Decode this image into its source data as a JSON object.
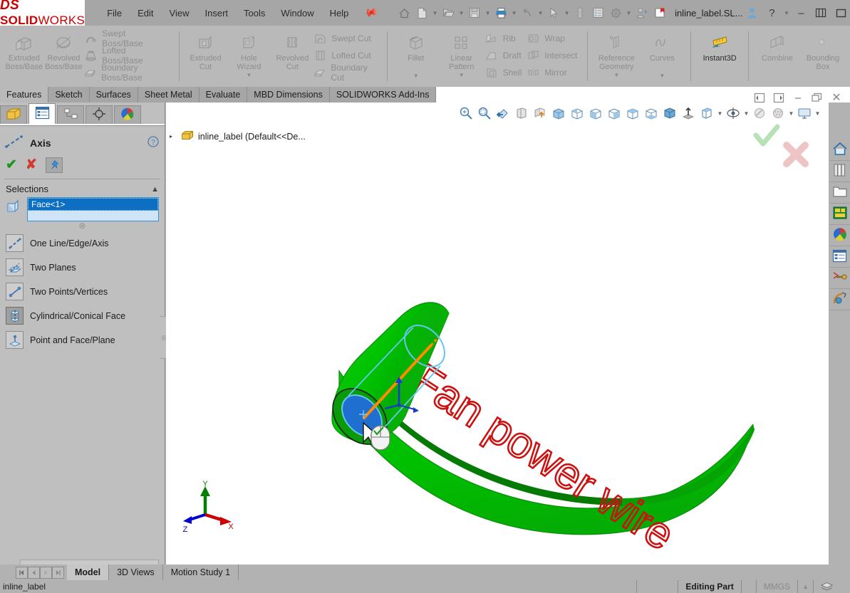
{
  "app": {
    "brand_ds": "DS",
    "brand_solid": "SOLID",
    "brand_works": "WORKS",
    "document_title": "inline_label.SL...",
    "accent_red": "#cc0000",
    "accent_blue": "#2a78c4",
    "model_green": "#00c000",
    "label_red": "#cc1111"
  },
  "menubar": {
    "items": [
      {
        "label": "File"
      },
      {
        "label": "Edit"
      },
      {
        "label": "View"
      },
      {
        "label": "Insert"
      },
      {
        "label": "Tools"
      },
      {
        "label": "Window"
      },
      {
        "label": "Help"
      }
    ],
    "pin_icon": "pushpin-icon"
  },
  "quick_access": {
    "buttons": [
      {
        "name": "home-icon"
      },
      {
        "name": "new-document-icon"
      },
      {
        "name": "open-folder-icon"
      },
      {
        "name": "save-icon"
      },
      {
        "name": "print-icon"
      },
      {
        "name": "undo-icon"
      },
      {
        "name": "select-arrow-icon"
      },
      {
        "name": "rebuild-icon"
      },
      {
        "name": "options-list-icon"
      },
      {
        "name": "gear-icon"
      },
      {
        "name": "user-login-icon"
      },
      {
        "name": "flag-icon"
      }
    ],
    "right_icons": [
      {
        "name": "user-account-icon"
      },
      {
        "name": "help-question-icon"
      }
    ]
  },
  "window_controls": {
    "minimize": "–",
    "restore": "❐",
    "close": "✕"
  },
  "ribbon": {
    "groups": [
      {
        "name": "boss-base-group",
        "big": [
          {
            "label_line1": "Extruded",
            "label_line2": "Boss/Base",
            "icon": "extruded-boss-icon",
            "enabled": false
          },
          {
            "label_line1": "Revolved",
            "label_line2": "Boss/Base",
            "icon": "revolved-boss-icon",
            "enabled": false
          }
        ],
        "list": [
          {
            "label": "Swept Boss/Base",
            "icon": "swept-boss-icon"
          },
          {
            "label": "Lofted Boss/Base",
            "icon": "lofted-boss-icon"
          },
          {
            "label": "Boundary Boss/Base",
            "icon": "boundary-boss-icon"
          }
        ]
      },
      {
        "name": "cut-group",
        "big": [
          {
            "label_line1": "Extruded",
            "label_line2": "Cut",
            "icon": "extruded-cut-icon",
            "enabled": false
          },
          {
            "label_line1": "Hole",
            "label_line2": "Wizard",
            "icon": "hole-wizard-icon",
            "enabled": false,
            "has_dropdown": true
          },
          {
            "label_line1": "Revolved",
            "label_line2": "Cut",
            "icon": "revolved-cut-icon",
            "enabled": false
          }
        ],
        "list": [
          {
            "label": "Swept Cut",
            "icon": "swept-cut-icon"
          },
          {
            "label": "Lofted Cut",
            "icon": "lofted-cut-icon"
          },
          {
            "label": "Boundary Cut",
            "icon": "boundary-cut-icon"
          }
        ]
      },
      {
        "name": "feature-group",
        "big": [
          {
            "label_line1": "Fillet",
            "label_line2": "",
            "icon": "fillet-icon",
            "enabled": false,
            "has_dropdown": true
          },
          {
            "label_line1": "Linear",
            "label_line2": "Pattern",
            "icon": "linear-pattern-icon",
            "enabled": false,
            "has_dropdown": true
          }
        ],
        "list": [
          {
            "label": "Rib",
            "icon": "rib-icon"
          },
          {
            "label": "Draft",
            "icon": "draft-icon"
          },
          {
            "label": "Shell",
            "icon": "shell-icon"
          }
        ],
        "list2": [
          {
            "label": "Wrap",
            "icon": "wrap-icon"
          },
          {
            "label": "Intersect",
            "icon": "intersect-icon"
          },
          {
            "label": "Mirror",
            "icon": "mirror-icon"
          }
        ]
      },
      {
        "name": "reference-group",
        "big": [
          {
            "label_line1": "Reference",
            "label_line2": "Geometry",
            "icon": "reference-geometry-icon",
            "enabled": false,
            "has_dropdown": true
          },
          {
            "label_line1": "Curves",
            "label_line2": "",
            "icon": "curves-icon",
            "enabled": false,
            "has_dropdown": true
          }
        ]
      },
      {
        "name": "instant3d-group",
        "big": [
          {
            "label_line1": "Instant3D",
            "label_line2": "",
            "icon": "instant3d-icon",
            "enabled": true
          }
        ]
      },
      {
        "name": "combine-group",
        "big": [
          {
            "label_line1": "Combine",
            "label_line2": "",
            "icon": "combine-icon",
            "enabled": false
          },
          {
            "label_line1": "Bounding",
            "label_line2": "Box",
            "icon": "bounding-box-icon",
            "enabled": false
          }
        ]
      }
    ]
  },
  "command_tabs": {
    "items": [
      {
        "label": "Features",
        "active": true
      },
      {
        "label": "Sketch",
        "active": false
      },
      {
        "label": "Surfaces",
        "active": false
      },
      {
        "label": "Sheet Metal",
        "active": false
      },
      {
        "label": "Evaluate",
        "active": false
      },
      {
        "label": "MBD Dimensions",
        "active": false
      },
      {
        "label": "SOLIDWORKS Add-Ins",
        "active": false
      }
    ]
  },
  "property_manager": {
    "tabs": [
      {
        "name": "feature-tree-tab",
        "icon": "feature-tree-icon",
        "active": false
      },
      {
        "name": "property-manager-tab",
        "icon": "property-manager-icon",
        "active": true
      },
      {
        "name": "configuration-manager-tab",
        "icon": "configuration-icon",
        "active": false
      },
      {
        "name": "dimxpert-manager-tab",
        "icon": "dimxpert-icon",
        "active": false
      },
      {
        "name": "display-manager-tab",
        "icon": "appearance-sphere-icon",
        "active": false
      }
    ],
    "title": "Axis",
    "title_icon": "axis-icon",
    "help_icon": "help-circle-icon",
    "actions": {
      "ok": "✔",
      "cancel": "✘",
      "pin": "pushpin-icon"
    },
    "sections": [
      {
        "name": "selections-section",
        "header": "Selections",
        "collapse_icon": "chevron-up-icon",
        "selection_box_icon": "face-selection-icon",
        "selected_items": [
          "Face<1>"
        ],
        "options": [
          {
            "label": "One Line/Edge/Axis",
            "icon": "line-edge-axis-icon",
            "selected": false
          },
          {
            "label": "Two Planes",
            "icon": "two-planes-icon",
            "selected": false
          },
          {
            "label": "Two Points/Vertices",
            "icon": "two-points-icon",
            "selected": false
          },
          {
            "label": "Cylindrical/Conical Face",
            "icon": "cylindrical-face-icon",
            "selected": true
          },
          {
            "label": "Point and Face/Plane",
            "icon": "point-and-face-icon",
            "selected": false
          }
        ]
      }
    ]
  },
  "graphics": {
    "view_toolbar": [
      {
        "name": "zoom-to-fit-icon"
      },
      {
        "name": "zoom-to-area-icon"
      },
      {
        "name": "previous-view-icon"
      },
      {
        "name": "section-view-icon"
      },
      {
        "name": "view-orientation-icon"
      },
      {
        "name": "front-view-icon"
      },
      {
        "name": "back-view-icon"
      },
      {
        "name": "left-view-icon"
      },
      {
        "name": "right-view-icon"
      },
      {
        "name": "top-view-icon"
      },
      {
        "name": "bottom-view-icon"
      },
      {
        "name": "isometric-view-icon"
      },
      {
        "name": "normal-to-icon"
      },
      {
        "name": "display-style-icon",
        "has_dropdown": true
      },
      {
        "name": "hide-show-items-icon",
        "has_dropdown": true
      },
      {
        "name": "edit-appearance-icon"
      },
      {
        "name": "apply-scene-icon",
        "has_dropdown": true
      },
      {
        "name": "view-settings-icon",
        "has_dropdown": true
      }
    ],
    "window_buttons": [
      {
        "name": "restore-down-left-icon",
        "glyph": "◀"
      },
      {
        "name": "restore-down-right-icon",
        "glyph": "▶"
      },
      {
        "name": "minimize-doc-icon",
        "glyph": "–"
      },
      {
        "name": "restore-doc-icon",
        "glyph": "❐"
      },
      {
        "name": "close-doc-icon",
        "glyph": "✕"
      }
    ],
    "tree": {
      "expand_arrow": "▸",
      "part_icon": "part-icon",
      "label": "inline_label  (Default<<De..."
    },
    "confirmation_corner": {
      "ok_icon": "checkmark-icon",
      "cancel_icon": "cross-icon"
    },
    "triad": {
      "x_label": "X",
      "y_label": "Y",
      "z_label": "Z",
      "x_color": "#cc0000",
      "y_color": "#008000",
      "z_color": "#0000cc"
    },
    "model": {
      "label_text": "Fan power wire",
      "body_color": "#00c000",
      "selected_face_color": "#1f6fd0",
      "axis_preview_color": "#ff8c00",
      "highlight_color": "#66c6f0",
      "cursor": "select-face-cursor"
    }
  },
  "task_pane": {
    "buttons": [
      {
        "name": "solidworks-resources-icon"
      },
      {
        "name": "design-library-icon"
      },
      {
        "name": "file-explorer-icon"
      },
      {
        "name": "view-palette-icon"
      },
      {
        "name": "appearances-scenes-icon"
      },
      {
        "name": "custom-properties-icon"
      },
      {
        "name": "solidworks-forum-icon"
      },
      {
        "name": "mbd-icon"
      }
    ]
  },
  "bottom_tabs": {
    "nav": [
      {
        "name": "first-tab-button",
        "glyph": "⏮"
      },
      {
        "name": "prev-tab-button",
        "glyph": "◀"
      },
      {
        "name": "next-tab-button",
        "glyph": "▶"
      },
      {
        "name": "last-tab-button",
        "glyph": "⏭"
      }
    ],
    "items": [
      {
        "label": "Model",
        "active": true
      },
      {
        "label": "3D Views",
        "active": false
      },
      {
        "label": "Motion Study 1",
        "active": false
      }
    ]
  },
  "status_bar": {
    "document": "inline_label",
    "mode": "Editing Part",
    "units": "MMGS",
    "units_caret": "▲",
    "overlay_icon": "layers-icon"
  }
}
